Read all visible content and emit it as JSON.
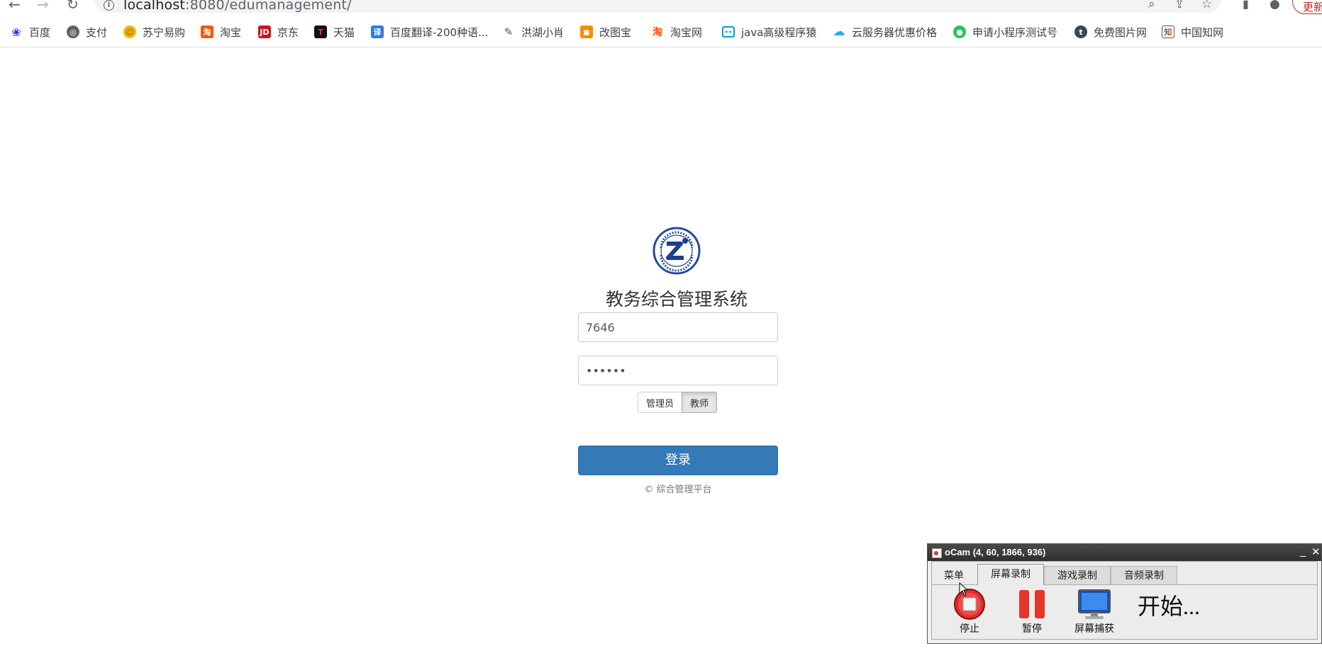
{
  "browser": {
    "url_host": "localhost",
    "url_path": ":8080/edumanagement/",
    "update_label": "更新",
    "bookmarks": [
      {
        "label": "百度",
        "icon": "paw-icon"
      },
      {
        "label": "支付",
        "icon": "globe-icon"
      },
      {
        "label": "苏宁易购",
        "icon": "lion-icon"
      },
      {
        "label": "淘宝",
        "icon": "taobao-icon"
      },
      {
        "label": "京东",
        "icon": "jd-icon"
      },
      {
        "label": "天猫",
        "icon": "tmall-icon"
      },
      {
        "label": "百度翻译-200种语...",
        "icon": "translate-icon"
      },
      {
        "label": "洪湖小肖",
        "icon": "feather-icon"
      },
      {
        "label": "改图宝",
        "icon": "gaitubao-icon"
      },
      {
        "label": "淘宝网",
        "icon": "taobao-icon"
      },
      {
        "label": "java高级程序猿",
        "icon": "bilibili-icon"
      },
      {
        "label": "云服务器优惠价格",
        "icon": "cloud-icon"
      },
      {
        "label": "申请小程序测试号",
        "icon": "wechat-icon"
      },
      {
        "label": "免费图片网",
        "icon": "tumblr-icon"
      },
      {
        "label": "中国知网",
        "icon": "cnki-icon"
      }
    ]
  },
  "login": {
    "title": "教务综合管理系统",
    "username_value": "7646",
    "password_value": "••••••",
    "roles": [
      "管理员",
      "教师"
    ],
    "selected_role": "教师",
    "submit_label": "登录",
    "copyright": "© 综合管理平台"
  },
  "ocam": {
    "title": "oCam (4, 60, 1866, 936)",
    "minimize": "_",
    "close": "✕",
    "tabs": [
      "菜单",
      "屏幕录制",
      "游戏录制",
      "音频录制"
    ],
    "active_tab": "屏幕录制",
    "tools": [
      "停止",
      "暂停",
      "屏幕捕获"
    ],
    "status": "开始..."
  },
  "colors": {
    "primary": "#337ab7",
    "update_red": "#c5221f"
  }
}
